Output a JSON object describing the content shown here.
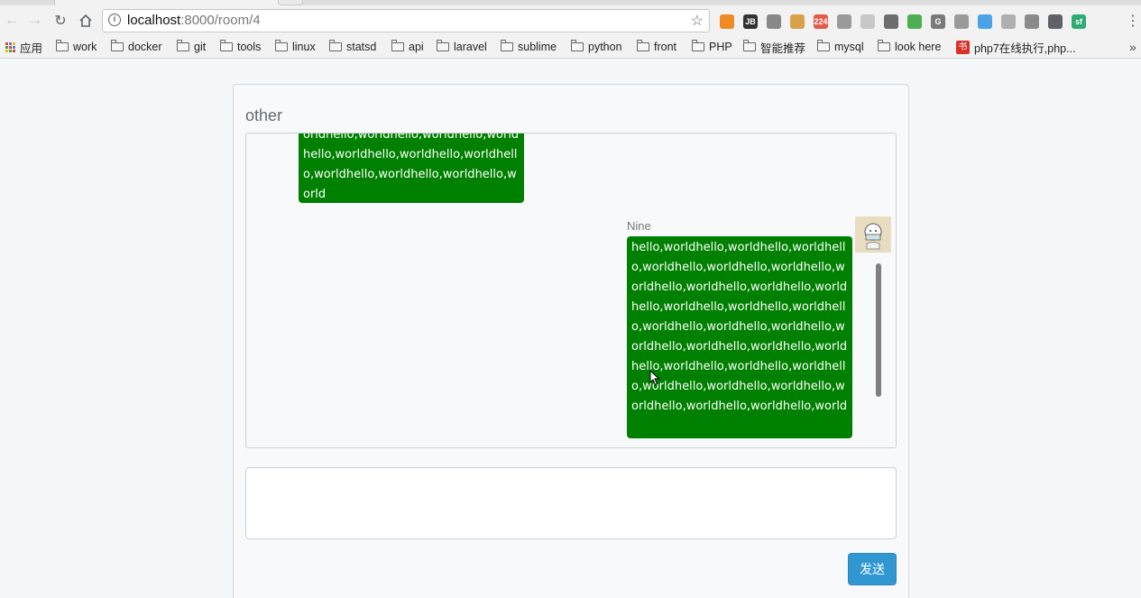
{
  "browser": {
    "url_host": "localhost",
    "url_rest": ":8000/room/4",
    "extensions": [
      {
        "name": "ext-orange-icon",
        "text": "",
        "color": "#f08a24"
      },
      {
        "name": "ext-jb-icon",
        "text": "JB",
        "color": "#333333"
      },
      {
        "name": "ext-sync-icon",
        "text": "",
        "color": "#888888"
      },
      {
        "name": "ext-cookie-icon",
        "text": "",
        "color": "#d9a14a"
      },
      {
        "name": "ext-mail-icon",
        "text": "224",
        "color": "#e35a4a"
      },
      {
        "name": "ext-gear-gray-icon",
        "text": "",
        "color": "#9a9a9a"
      },
      {
        "name": "ext-cloud-icon",
        "text": "",
        "color": "#c8c8c8"
      },
      {
        "name": "ext-screen-icon",
        "text": "",
        "color": "#6d6d6d"
      },
      {
        "name": "ext-color-icon",
        "text": "",
        "color": "#4caf50"
      },
      {
        "name": "ext-g-icon",
        "text": "G",
        "color": "#7a7a7a"
      },
      {
        "name": "ext-recycle-icon",
        "text": "",
        "color": "#9a9a9a"
      },
      {
        "name": "ext-download-icon",
        "text": "",
        "color": "#4aa3e8"
      },
      {
        "name": "ext-vue-icon",
        "text": "",
        "color": "#b0b0b0"
      },
      {
        "name": "ext-settings-icon",
        "text": "",
        "color": "#8a8a8a"
      },
      {
        "name": "ext-evernote-icon",
        "text": "",
        "color": "#5f6368"
      },
      {
        "name": "ext-sf-icon",
        "text": "sf",
        "color": "#2faa77"
      }
    ]
  },
  "bookmarks": {
    "apps_label": "应用",
    "items": [
      "work",
      "docker",
      "git",
      "tools",
      "linux",
      "statsd",
      "api",
      "laravel",
      "sublime",
      "python",
      "front",
      "PHP",
      "智能推荐",
      "mysql",
      "look here"
    ],
    "special_label": "php7在线执行,php...",
    "more": "»"
  },
  "room": {
    "title": "other",
    "messages": [
      {
        "from": "other",
        "text": "orldhello,worldhello,worldhello,worldhello,worldhello,worldhello,worldhello,worldhello,worldhello,worldhello,world"
      },
      {
        "from": "mine",
        "sender": "Nine",
        "text": "hello,worldhello,worldhello,worldhello,worldhello,worldhello,worldhello,worldhello,worldhello,worldhello,worldhello,worldhello,worldhello,worldhello,worldhello,worldhello,worldhello,worldhello,worldhello,worldhello,worldhello,worldhello,worldhello,worldhello,worldhello,worldhello,worldhello,worldhello,worldhello,worldhello,world"
      }
    ],
    "input_placeholder": "",
    "send_label": "发送"
  }
}
